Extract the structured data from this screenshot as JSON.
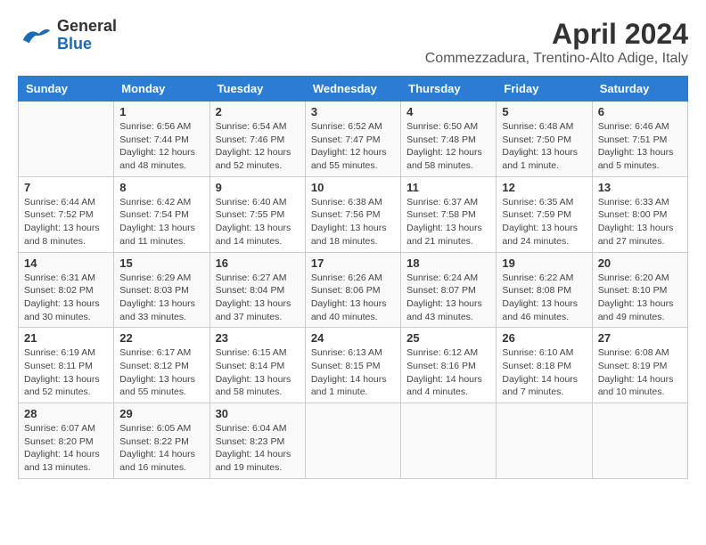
{
  "header": {
    "logo_line1": "General",
    "logo_line2": "Blue",
    "title": "April 2024",
    "subtitle": "Commezzadura, Trentino-Alto Adige, Italy"
  },
  "columns": [
    "Sunday",
    "Monday",
    "Tuesday",
    "Wednesday",
    "Thursday",
    "Friday",
    "Saturday"
  ],
  "weeks": [
    [
      {
        "day": "",
        "info": ""
      },
      {
        "day": "1",
        "info": "Sunrise: 6:56 AM\nSunset: 7:44 PM\nDaylight: 12 hours\nand 48 minutes."
      },
      {
        "day": "2",
        "info": "Sunrise: 6:54 AM\nSunset: 7:46 PM\nDaylight: 12 hours\nand 52 minutes."
      },
      {
        "day": "3",
        "info": "Sunrise: 6:52 AM\nSunset: 7:47 PM\nDaylight: 12 hours\nand 55 minutes."
      },
      {
        "day": "4",
        "info": "Sunrise: 6:50 AM\nSunset: 7:48 PM\nDaylight: 12 hours\nand 58 minutes."
      },
      {
        "day": "5",
        "info": "Sunrise: 6:48 AM\nSunset: 7:50 PM\nDaylight: 13 hours\nand 1 minute."
      },
      {
        "day": "6",
        "info": "Sunrise: 6:46 AM\nSunset: 7:51 PM\nDaylight: 13 hours\nand 5 minutes."
      }
    ],
    [
      {
        "day": "7",
        "info": "Sunrise: 6:44 AM\nSunset: 7:52 PM\nDaylight: 13 hours\nand 8 minutes."
      },
      {
        "day": "8",
        "info": "Sunrise: 6:42 AM\nSunset: 7:54 PM\nDaylight: 13 hours\nand 11 minutes."
      },
      {
        "day": "9",
        "info": "Sunrise: 6:40 AM\nSunset: 7:55 PM\nDaylight: 13 hours\nand 14 minutes."
      },
      {
        "day": "10",
        "info": "Sunrise: 6:38 AM\nSunset: 7:56 PM\nDaylight: 13 hours\nand 18 minutes."
      },
      {
        "day": "11",
        "info": "Sunrise: 6:37 AM\nSunset: 7:58 PM\nDaylight: 13 hours\nand 21 minutes."
      },
      {
        "day": "12",
        "info": "Sunrise: 6:35 AM\nSunset: 7:59 PM\nDaylight: 13 hours\nand 24 minutes."
      },
      {
        "day": "13",
        "info": "Sunrise: 6:33 AM\nSunset: 8:00 PM\nDaylight: 13 hours\nand 27 minutes."
      }
    ],
    [
      {
        "day": "14",
        "info": "Sunrise: 6:31 AM\nSunset: 8:02 PM\nDaylight: 13 hours\nand 30 minutes."
      },
      {
        "day": "15",
        "info": "Sunrise: 6:29 AM\nSunset: 8:03 PM\nDaylight: 13 hours\nand 33 minutes."
      },
      {
        "day": "16",
        "info": "Sunrise: 6:27 AM\nSunset: 8:04 PM\nDaylight: 13 hours\nand 37 minutes."
      },
      {
        "day": "17",
        "info": "Sunrise: 6:26 AM\nSunset: 8:06 PM\nDaylight: 13 hours\nand 40 minutes."
      },
      {
        "day": "18",
        "info": "Sunrise: 6:24 AM\nSunset: 8:07 PM\nDaylight: 13 hours\nand 43 minutes."
      },
      {
        "day": "19",
        "info": "Sunrise: 6:22 AM\nSunset: 8:08 PM\nDaylight: 13 hours\nand 46 minutes."
      },
      {
        "day": "20",
        "info": "Sunrise: 6:20 AM\nSunset: 8:10 PM\nDaylight: 13 hours\nand 49 minutes."
      }
    ],
    [
      {
        "day": "21",
        "info": "Sunrise: 6:19 AM\nSunset: 8:11 PM\nDaylight: 13 hours\nand 52 minutes."
      },
      {
        "day": "22",
        "info": "Sunrise: 6:17 AM\nSunset: 8:12 PM\nDaylight: 13 hours\nand 55 minutes."
      },
      {
        "day": "23",
        "info": "Sunrise: 6:15 AM\nSunset: 8:14 PM\nDaylight: 13 hours\nand 58 minutes."
      },
      {
        "day": "24",
        "info": "Sunrise: 6:13 AM\nSunset: 8:15 PM\nDaylight: 14 hours\nand 1 minute."
      },
      {
        "day": "25",
        "info": "Sunrise: 6:12 AM\nSunset: 8:16 PM\nDaylight: 14 hours\nand 4 minutes."
      },
      {
        "day": "26",
        "info": "Sunrise: 6:10 AM\nSunset: 8:18 PM\nDaylight: 14 hours\nand 7 minutes."
      },
      {
        "day": "27",
        "info": "Sunrise: 6:08 AM\nSunset: 8:19 PM\nDaylight: 14 hours\nand 10 minutes."
      }
    ],
    [
      {
        "day": "28",
        "info": "Sunrise: 6:07 AM\nSunset: 8:20 PM\nDaylight: 14 hours\nand 13 minutes."
      },
      {
        "day": "29",
        "info": "Sunrise: 6:05 AM\nSunset: 8:22 PM\nDaylight: 14 hours\nand 16 minutes."
      },
      {
        "day": "30",
        "info": "Sunrise: 6:04 AM\nSunset: 8:23 PM\nDaylight: 14 hours\nand 19 minutes."
      },
      {
        "day": "",
        "info": ""
      },
      {
        "day": "",
        "info": ""
      },
      {
        "day": "",
        "info": ""
      },
      {
        "day": "",
        "info": ""
      }
    ]
  ]
}
